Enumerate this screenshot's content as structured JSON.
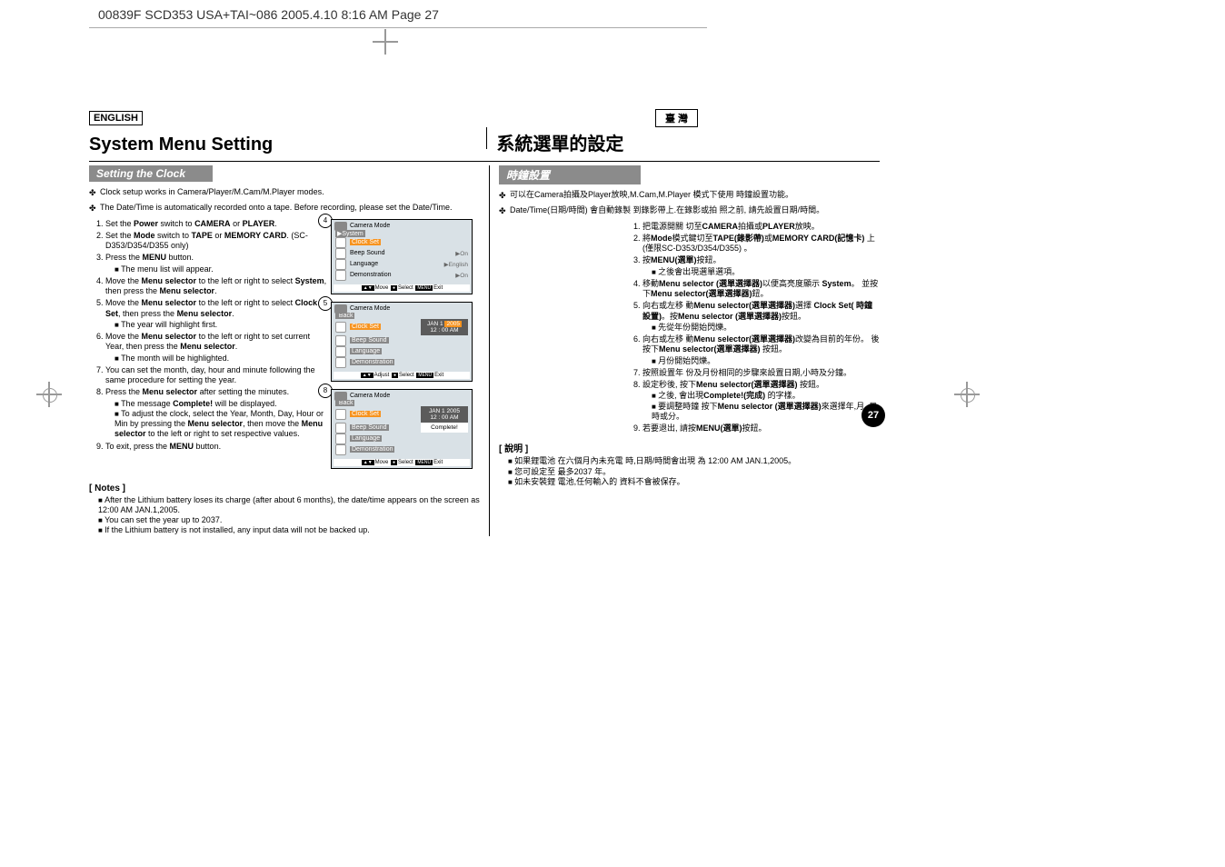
{
  "runhead": "00839F SCD353 USA+TAI~086  2005.4.10  8:16 AM  Page 27",
  "lang_en": "ENGLISH",
  "lang_tw": "臺 灣",
  "title_en": "System Menu Setting",
  "title_tw": "系統選單的設定",
  "section_en": "Setting the Clock",
  "section_tw": "時鐘設置",
  "intro_en_1": "Clock setup works in Camera/Player/M.Cam/M.Player modes.",
  "intro_en_2": "The Date/Time is automatically recorded onto a tape. Before recording, please set the Date/Time.",
  "intro_tw_1": "可以在Camera拍攝及Player放映,M.Cam,M.Player 模式下使用 時鐘設置功能。",
  "intro_tw_2": "Date/Time(日期/時間) 會自動錄製 到錄影帶上.在錄影或拍 照之前, 請先設置日期/時間。",
  "steps_en": [
    "Set the <b>Power</b> switch to <b>CAMERA</b> or <b>PLAYER</b>.",
    "Set the <b>Mode</b> switch to <b>TAPE</b> or <b>MEMORY CARD</b>. (SC-D353/D354/D355 only)",
    "Press the <b>MENU</b> button.",
    "Move the <b>Menu selector</b> to the left or right to select <b>System</b>, then press the <b>Menu selector</b>.",
    "Move the <b>Menu selector</b> to the left or right to select <b>Clock Set</b>, then press the <b>Menu selector</b>.",
    "Move the <b>Menu selector</b> to the left or right to set current Year, then press the <b>Menu selector</b>.",
    "You can set the month, day, hour and minute following the same procedure for setting the year.",
    "Press the <b>Menu selector</b> after setting the minutes.",
    "To exit, press the <b>MENU</b> button."
  ],
  "sub_en": {
    "3": [
      "The menu list will appear."
    ],
    "5": [
      "The year will highlight first."
    ],
    "6": [
      "The month will be highlighted."
    ],
    "8": [
      "The message <b>Complete!</b> will be displayed.",
      "To adjust the clock, select the Year, Month, Day, Hour or Min by pressing the <b>Menu selector</b>, then move the <b>Menu selector</b> to the left or right to set respective values."
    ]
  },
  "steps_tw": [
    "把電源開關 切至<b>CAMERA</b>拍攝或<b>PLAYER</b>放映。",
    "將<b>Mode</b>模式鍵切至<b>TAPE(錄影帶)</b>或<b>MEMORY CARD(記憶卡)</b> 上(僅限SC-D353/D354/D355) 。",
    "按<b>MENU(選單)</b>按鈕。",
    "移動<b>Menu selector (選單選擇器)</b>以便高亮度顯示 <b>System</b>。 並按下<b>Menu selector(選單選擇器)</b>鈕。",
    "向右或左移 動<b>Menu selector(選單選擇器)</b>選擇 <b>Clock Set( 時鐘設置)</b>。按<b>Menu selector (選單選擇器)</b>按鈕。",
    "向右或左移 動<b>Menu selector(選單選擇器)</b>改變為目前的年份。 後按下<b>Menu selector(選單選擇器)</b> 按鈕。",
    "按照設置年 份及月份相同的步驟來設置日期,小時及分鐘。",
    "設定秒後, 按下<b>Menu selector(選單選擇器)</b> 按鈕。",
    "若要退出, 請按<b>MENU(選單)</b>按鈕。"
  ],
  "sub_tw": {
    "3": [
      "之後會出現選單選項。"
    ],
    "5": [
      "先從年份開始閃爍。"
    ],
    "6": [
      "月份開始閃爍。"
    ],
    "8": [
      "之後, 會出現<b>Complete!(完成)</b> 的字樣。",
      "要調整時鐘 按下<b>Menu selector (選單選擇器)</b>來選擇年,月, 日,時或分。"
    ]
  },
  "notes_head_en": "[ Notes ]",
  "notes_en": [
    "After the Lithium battery loses its charge (after about 6 months), the date/time appears on the screen as 12:00 AM JAN.1,2005.",
    "You can set the year up to 2037.",
    "If the Lithium battery is not installed, any input data will not be backed up."
  ],
  "notes_head_tw": "[ 說明 ]",
  "notes_tw": [
    "如果鋰電池 在六個月內未充電 時,日期/時間會出現 為 12:00 AM JAN.1,2005。",
    "您可設定至 最多2037 年。",
    "如未安裝鋰 電池,任何輸入的 資料不會被保存。"
  ],
  "fig_callouts": [
    "4",
    "5",
    "8"
  ],
  "osd": {
    "title": "Camera Mode",
    "sys_label": "▶System",
    "back_label": "Back",
    "rows": {
      "clock": "Clock Set",
      "beep": "Beep Sound",
      "lang": "Language",
      "demo": "Demonstration"
    },
    "vals": {
      "beep": "▶On",
      "lang": "▶English",
      "demo": "▶On"
    },
    "date1": "JAN  1",
    "year1": "2005",
    "time1": "12 : 00   AM",
    "date2": "JAN  1  2005",
    "time2": "12 : 00   AM",
    "complete": "Complete!",
    "footer_move": "Move",
    "footer_adjust": "Adjust",
    "footer_select": "Select",
    "footer_exit": "Exit",
    "footer_menu": "MENU"
  },
  "page_number": "27"
}
